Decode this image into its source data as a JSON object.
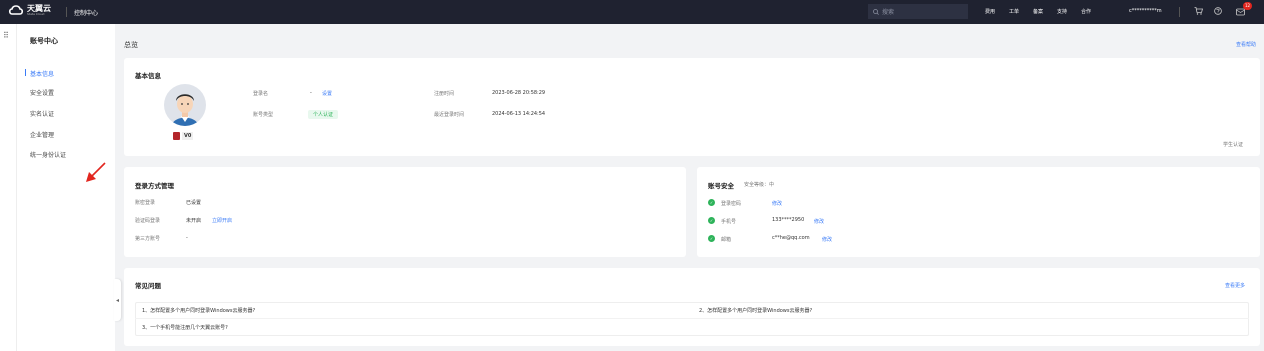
{
  "topbar": {
    "logo_text": "天翼云",
    "logo_sub": "State Cloud",
    "console": "控制中心",
    "search_placeholder": "搜索",
    "nav": [
      "费用",
      "工单",
      "备案",
      "支持",
      "合作"
    ],
    "user": "c**********m",
    "notification_count": "12"
  },
  "sidebar": {
    "title": "账号中心",
    "items": [
      "基本信息",
      "安全设置",
      "实名认证",
      "企业管理",
      "统一身份认证"
    ]
  },
  "page": {
    "title": "总览",
    "help": "查看帮助"
  },
  "basic": {
    "title": "基本信息",
    "vip_level": "V0",
    "login_name_label": "登录名",
    "login_name_value": "-",
    "login_name_action": "设置",
    "account_type_label": "账号类型",
    "account_type_value": "个人认证",
    "register_label": "注册时间",
    "register_value": "2023-06-28 20:58:29",
    "last_login_label": "最近登录时间",
    "last_login_value": "2024-06-13 14:24:54",
    "student": "学生认证"
  },
  "login_methods": {
    "title": "登录方式管理",
    "rows": [
      {
        "label": "账密登录",
        "value": "已设置",
        "action": ""
      },
      {
        "label": "验证码登录",
        "value": "未开启",
        "action": "立即开启"
      },
      {
        "label": "第三方账号",
        "value": "-",
        "action": ""
      }
    ]
  },
  "security": {
    "title": "账号安全",
    "level": "安全等级：中",
    "rows": [
      {
        "label": "登录密码",
        "value": "",
        "action": "修改"
      },
      {
        "label": "手机号",
        "value": "133****2950",
        "action": "修改"
      },
      {
        "label": "邮箱",
        "value": "c**he@qq.com",
        "action": "修改"
      }
    ],
    "status_color": "#2eb35a"
  },
  "faq": {
    "title": "常见问题",
    "more": "查看更多",
    "items": [
      "1、怎样配置多个用户同时登录Windows云服务器?",
      "2、怎样配置多个用户同时登录Windows云服务器?",
      "3、一个手机号能注册几个天翼云账号?"
    ]
  },
  "colors": {
    "accent": "#3a7bf7",
    "topbar": "#1f2230",
    "danger": "#e2261f"
  }
}
